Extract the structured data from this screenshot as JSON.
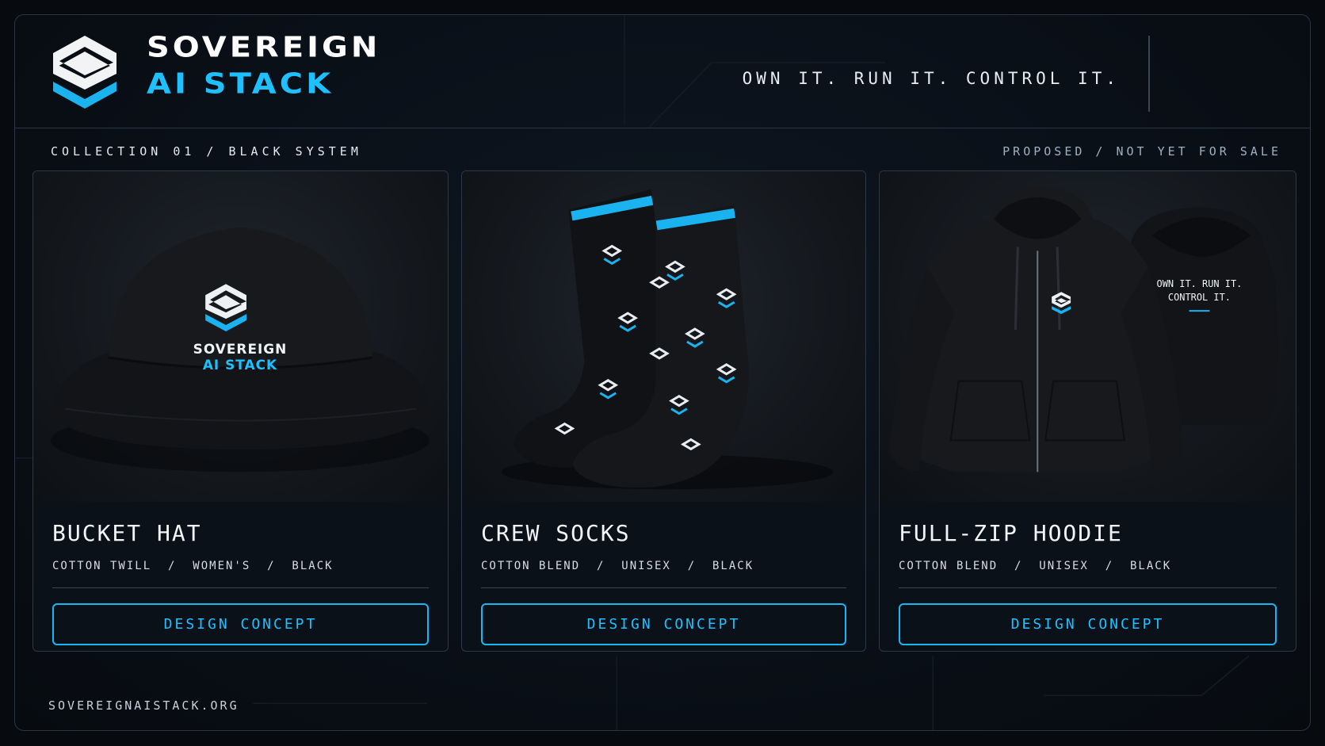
{
  "brand": {
    "name_line1": "SOVEREIGN",
    "name_line2": "AI STACK",
    "tagline": "OWN IT. RUN IT. CONTROL IT.",
    "logo_icon": "layered-s-cube-logo",
    "accent_color": "#1ec0ff"
  },
  "collection": {
    "label": "COLLECTION 01 / BLACK SYSTEM",
    "status": "PROPOSED / NOT YET FOR SALE"
  },
  "products": [
    {
      "title": "BUCKET HAT",
      "specs": "COTTON TWILL  /  WOMEN'S  /  BLACK",
      "cta": "DESIGN CONCEPT",
      "image_icon": "bucket-hat-image",
      "print_line1": "SOVEREIGN",
      "print_line2": "AI STACK"
    },
    {
      "title": "CREW SOCKS",
      "specs": "COTTON BLEND  /  UNISEX  /  BLACK",
      "cta": "DESIGN CONCEPT",
      "image_icon": "crew-socks-image"
    },
    {
      "title": "FULL-ZIP HOODIE",
      "specs": "COTTON BLEND  /  UNISEX  /  BLACK",
      "cta": "DESIGN CONCEPT",
      "image_icon": "hoodie-image",
      "back_print_line1": "OWN IT. RUN IT.",
      "back_print_line2": "CONTROL IT."
    }
  ],
  "footer": {
    "url": "SOVEREIGNAISTACK.ORG"
  }
}
